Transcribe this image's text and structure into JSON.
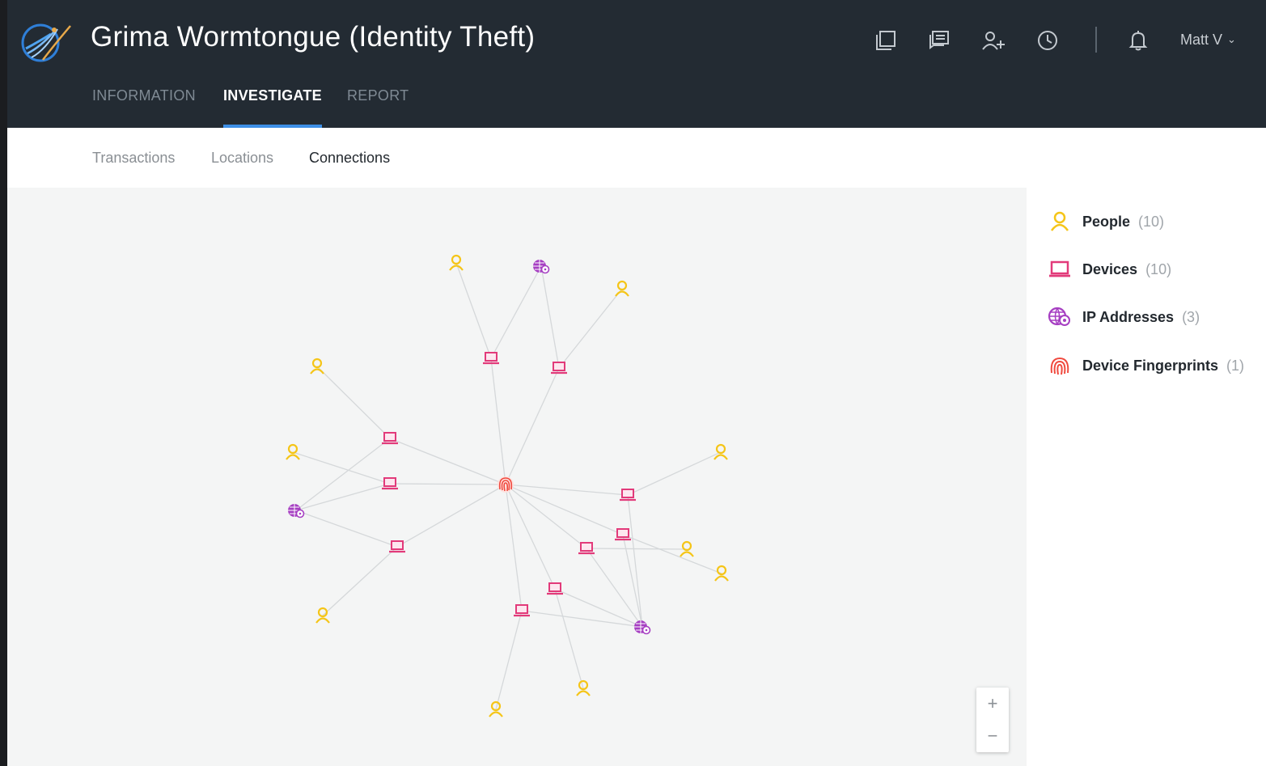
{
  "header": {
    "case_title": "Grima Wormtongue (Identity Theft)",
    "user_name": "Matt V",
    "actions": [
      "copy-icon",
      "comments-icon",
      "add-user-icon",
      "history-icon",
      "bell-icon"
    ]
  },
  "tabs": [
    {
      "label": "INFORMATION",
      "active": false
    },
    {
      "label": "INVESTIGATE",
      "active": true
    },
    {
      "label": "REPORT",
      "active": false
    }
  ],
  "subtabs": [
    {
      "label": "Transactions",
      "active": false
    },
    {
      "label": "Locations",
      "active": false
    },
    {
      "label": "Connections",
      "active": true
    }
  ],
  "legend": [
    {
      "label": "People",
      "count": "(10)",
      "icon": "person-icon",
      "color": "#f5c518"
    },
    {
      "label": "Devices",
      "count": "(10)",
      "icon": "laptop-icon",
      "color": "#e23a7a"
    },
    {
      "label": "IP Addresses",
      "count": "(3)",
      "icon": "ip-globe-icon",
      "color": "#a63fc2"
    },
    {
      "label": "Device Fingerprints",
      "count": "(1)",
      "icon": "fingerprint-icon",
      "color": "#f0493e"
    }
  ],
  "zoom": {
    "in": "+",
    "out": "−"
  },
  "colors": {
    "topbar": "#232b33",
    "accent": "#3d8fe6",
    "person": "#f5c518",
    "device": "#e23a7a",
    "ip": "#a63fc2",
    "fingerprint": "#f0493e"
  }
}
